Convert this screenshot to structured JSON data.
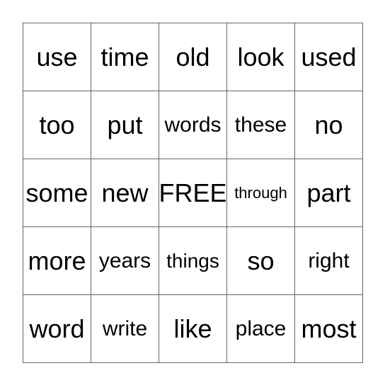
{
  "card": {
    "rows": [
      [
        "use",
        "time",
        "old",
        "look",
        "used"
      ],
      [
        "too",
        "put",
        "words",
        "these",
        "no"
      ],
      [
        "some",
        "new",
        "FREE",
        "through",
        "part"
      ],
      [
        "more",
        "years",
        "things",
        "so",
        "right"
      ],
      [
        "word",
        "write",
        "like",
        "place",
        "most"
      ]
    ]
  }
}
